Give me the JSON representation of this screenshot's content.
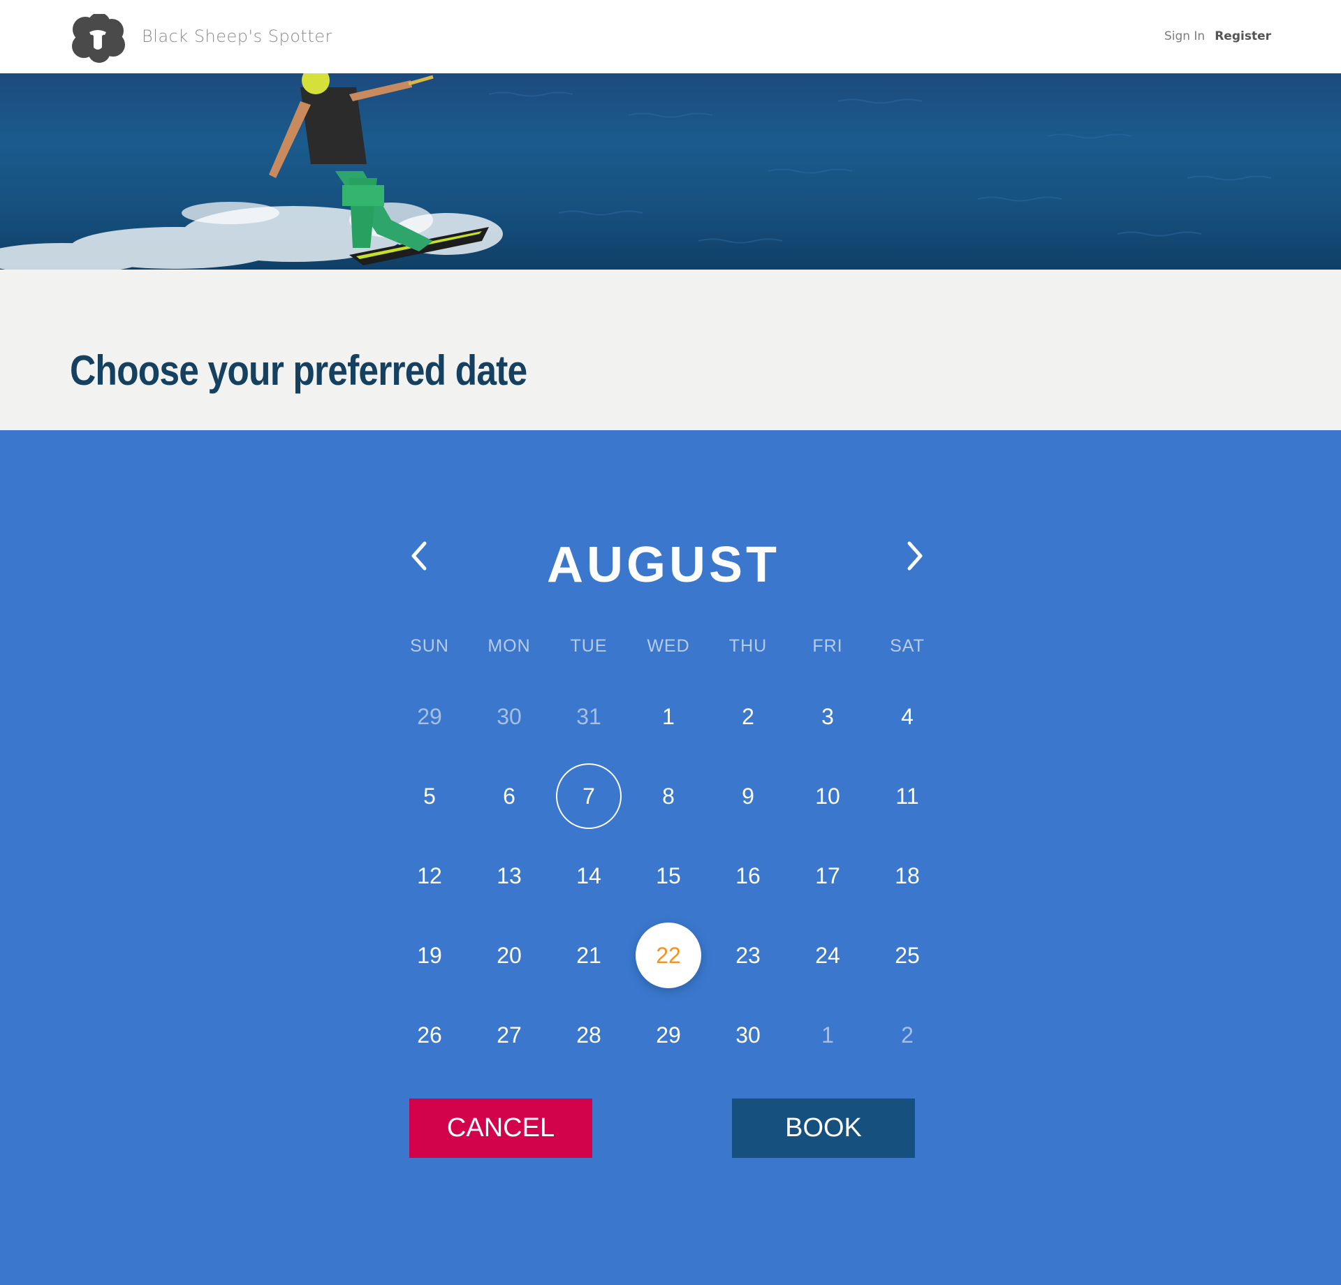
{
  "header": {
    "brand": "Black Sheep's Spotter",
    "sign_in": "Sign In",
    "register": "Register"
  },
  "hero": {
    "image": "wakeboarder-on-lake"
  },
  "page": {
    "title": "Choose your preferred date"
  },
  "calendar": {
    "month": "AUGUST",
    "weekdays": [
      "SUN",
      "MON",
      "TUE",
      "WED",
      "THU",
      "FRI",
      "SAT"
    ],
    "weeks": [
      [
        {
          "d": "29",
          "muted": true
        },
        {
          "d": "30",
          "muted": true
        },
        {
          "d": "31",
          "muted": true
        },
        {
          "d": "1"
        },
        {
          "d": "2"
        },
        {
          "d": "3"
        },
        {
          "d": "4"
        }
      ],
      [
        {
          "d": "5"
        },
        {
          "d": "6"
        },
        {
          "d": "7",
          "today": true
        },
        {
          "d": "8"
        },
        {
          "d": "9"
        },
        {
          "d": "10"
        },
        {
          "d": "11"
        }
      ],
      [
        {
          "d": "12"
        },
        {
          "d": "13"
        },
        {
          "d": "14"
        },
        {
          "d": "15"
        },
        {
          "d": "16"
        },
        {
          "d": "17"
        },
        {
          "d": "18"
        }
      ],
      [
        {
          "d": "19"
        },
        {
          "d": "20"
        },
        {
          "d": "21"
        },
        {
          "d": "22",
          "selected": true
        },
        {
          "d": "23"
        },
        {
          "d": "24"
        },
        {
          "d": "25"
        }
      ],
      [
        {
          "d": "26"
        },
        {
          "d": "27"
        },
        {
          "d": "28"
        },
        {
          "d": "29"
        },
        {
          "d": "30"
        },
        {
          "d": "1",
          "muted": true
        },
        {
          "d": "2",
          "muted": true
        }
      ]
    ],
    "cancel_label": "CANCEL",
    "book_label": "BOOK"
  },
  "colors": {
    "calendar_bg": "#3b78cd",
    "title_text": "#15405f",
    "cancel_bg": "#d2034a",
    "book_bg": "#16507e",
    "selected_text": "#f5931f"
  }
}
